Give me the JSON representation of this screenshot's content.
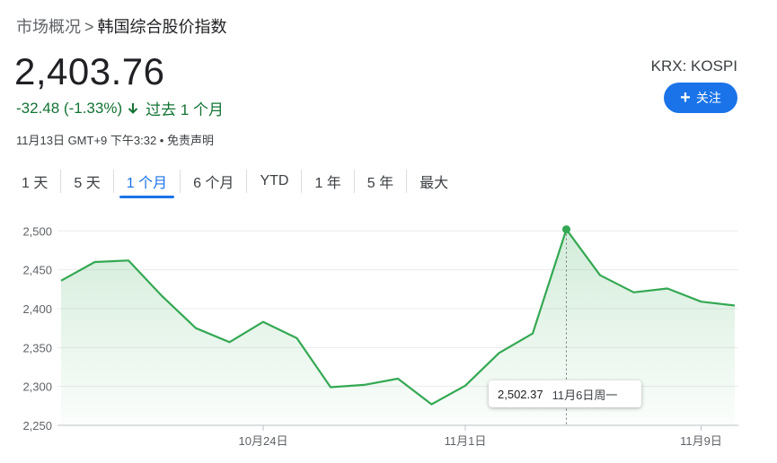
{
  "breadcrumb": {
    "parent": "市场概况",
    "separator": ">",
    "current": "韩国综合股价指数"
  },
  "quote": {
    "price": "2,403.76",
    "change": "-32.48 (-1.33%)",
    "period": "过去 1 个月",
    "meta": "11月13日 GMT+9 下午3:32 • 免责声明",
    "exchange": "KRX: KOSPI"
  },
  "follow_button": {
    "label": "关注"
  },
  "tabs": [
    {
      "label": "1 天",
      "active": false
    },
    {
      "label": "5 天",
      "active": false
    },
    {
      "label": "1 个月",
      "active": true
    },
    {
      "label": "6 个月",
      "active": false
    },
    {
      "label": "YTD",
      "active": false
    },
    {
      "label": "1 年",
      "active": false
    },
    {
      "label": "5 年",
      "active": false
    },
    {
      "label": "最大",
      "active": false
    }
  ],
  "colors": {
    "line": "#34a853",
    "accent": "#1a73e8",
    "down": "#137333"
  },
  "tooltip": {
    "value": "2,502.37",
    "date": "11月6日周一"
  },
  "chart_data": {
    "type": "area",
    "ylim": [
      2250,
      2520
    ],
    "yticks": [
      {
        "value": 2250,
        "label": "2,250"
      },
      {
        "value": 2300,
        "label": "2,300"
      },
      {
        "value": 2350,
        "label": "2,350"
      },
      {
        "value": 2400,
        "label": "2,400"
      },
      {
        "value": 2450,
        "label": "2,450"
      },
      {
        "value": 2500,
        "label": "2,500"
      }
    ],
    "xticks": [
      {
        "index": 6,
        "label": "10月24日"
      },
      {
        "index": 12,
        "label": "11月1日"
      },
      {
        "index": 19,
        "label": "11月9日"
      }
    ],
    "values": [
      2436,
      2460,
      2462,
      2416,
      2375,
      2357,
      2383,
      2362,
      2299,
      2302,
      2310,
      2277,
      2301,
      2343,
      2368,
      2502,
      2443,
      2421,
      2426,
      2409,
      2404
    ],
    "highlight_index": 15
  }
}
